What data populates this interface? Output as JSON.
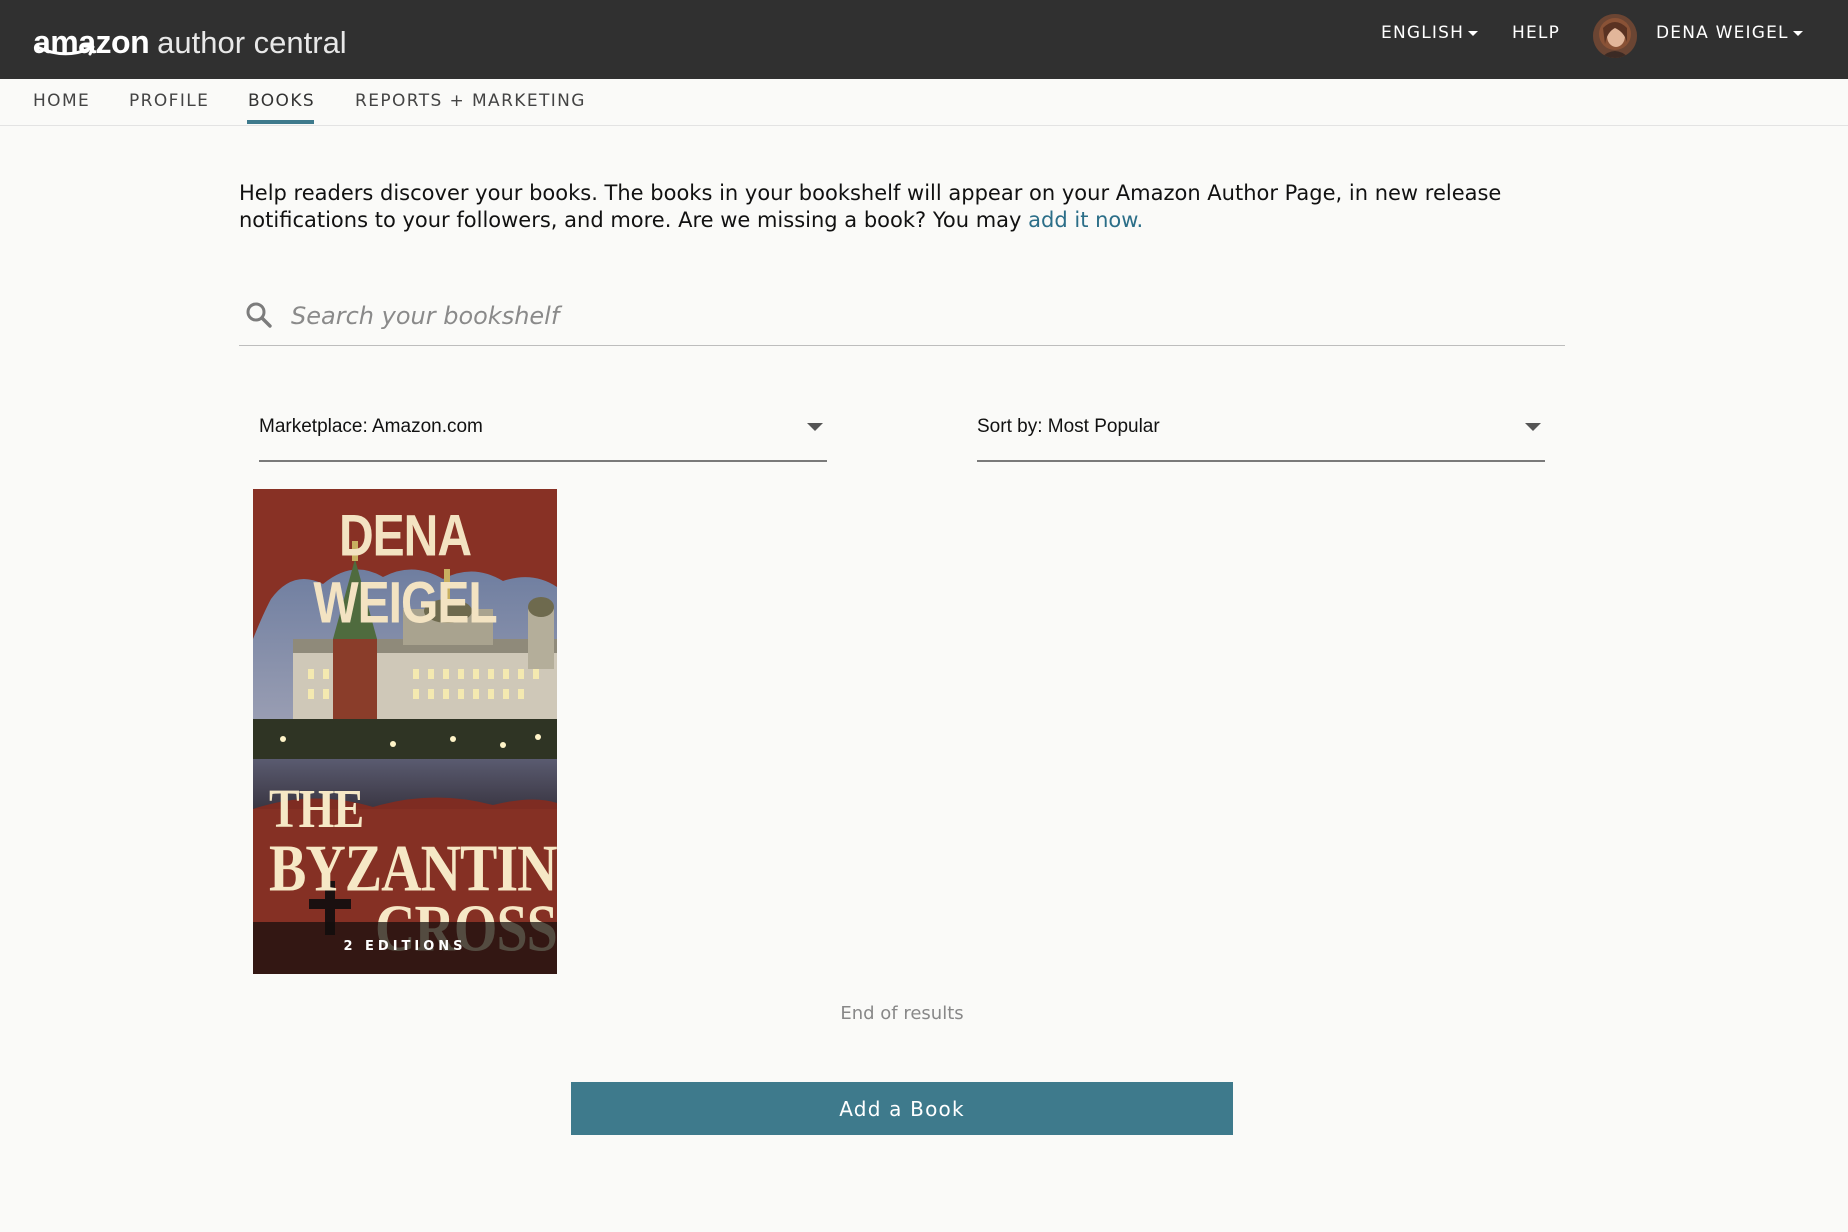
{
  "header": {
    "logo_brand": "amazon",
    "logo_product": "author central",
    "language_label": "ENGLISH",
    "help_label": "HELP",
    "user_name": "DENA WEIGEL"
  },
  "nav": {
    "tabs": [
      {
        "label": "HOME",
        "active": false
      },
      {
        "label": "PROFILE",
        "active": false
      },
      {
        "label": "BOOKS",
        "active": true
      },
      {
        "label": "REPORTS + MARKETING",
        "active": false
      }
    ]
  },
  "main": {
    "intro_text": "Help readers discover your books. The books in your bookshelf will appear on your Amazon Author Page, in new release notifications to your followers, and more. Are we missing a book? You may ",
    "intro_link": "add it now.",
    "search_placeholder": "Search your bookshelf",
    "marketplace_select": "Marketplace: Amazon.com",
    "sort_select": "Sort by: Most Popular",
    "books": [
      {
        "cover_author": "DENA WEIGEL",
        "cover_title_line1": "THE",
        "cover_title_line2": "BYZANTINE",
        "cover_title_line3": "CROSS",
        "editions": "2 EDITIONS"
      }
    ],
    "end_text": "End of results",
    "add_book_label": "Add a Book"
  },
  "colors": {
    "topbar": "#303030",
    "accent": "#3e7a8c",
    "link": "#2b6e88"
  }
}
